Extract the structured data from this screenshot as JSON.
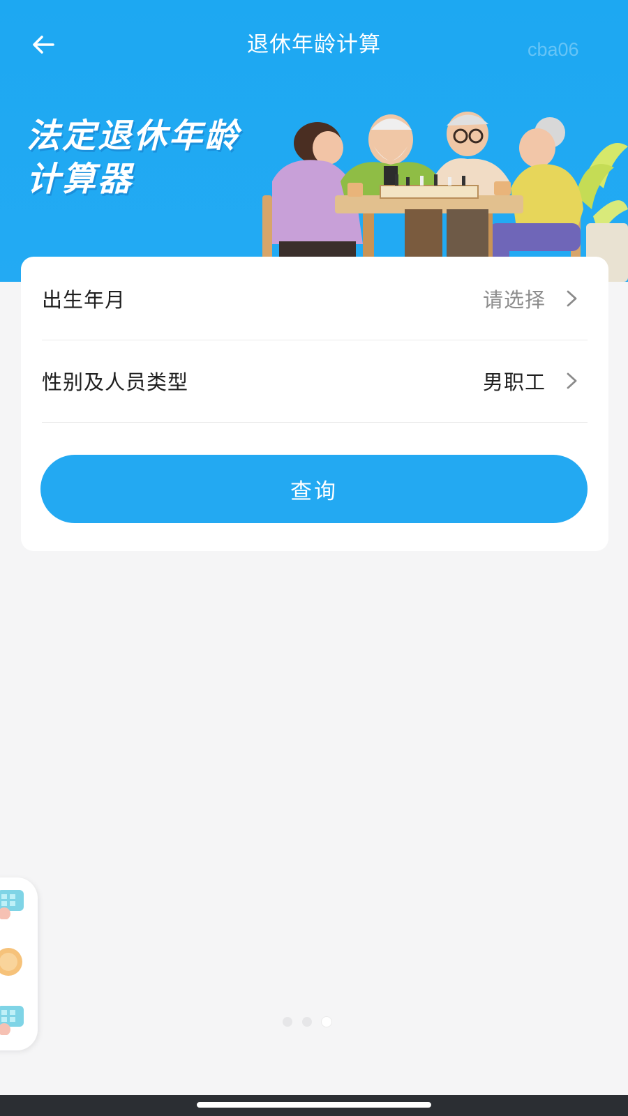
{
  "header": {
    "title": "退休年龄计算",
    "watermark": "cba06"
  },
  "hero": {
    "title_line1": "法定退休年龄",
    "title_line2": "计算器"
  },
  "form": {
    "birth": {
      "label": "出生年月",
      "value": "请选择"
    },
    "gender_type": {
      "label": "性别及人员类型",
      "value": "男职工"
    },
    "query_button": "查询"
  },
  "pager": {
    "total": 3,
    "active_index": 2
  },
  "colors": {
    "primary": "#23a9f2",
    "background": "#f5f5f6",
    "card": "#ffffff",
    "placeholder": "#8c8c8c"
  },
  "icons": {
    "back": "arrow-left-icon",
    "chevron": "chevron-right-icon"
  }
}
